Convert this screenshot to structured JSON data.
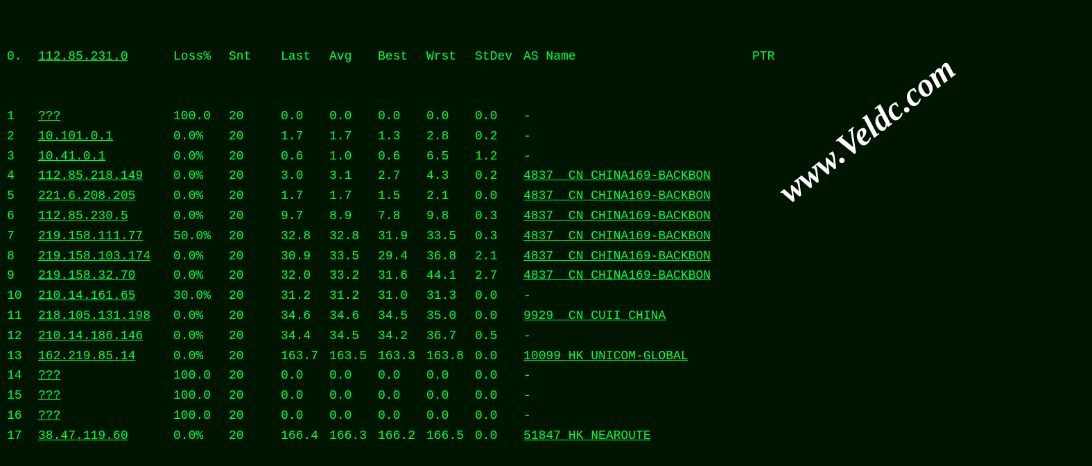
{
  "header": {
    "num": "0.",
    "host": "112.85.231.0",
    "loss": "Loss%",
    "snt": "Snt",
    "last": "Last",
    "avg": "Avg",
    "best": "Best",
    "wrst": "Wrst",
    "stdev": "StDev",
    "asname": "AS Name",
    "ptr": "PTR"
  },
  "rows": [
    {
      "num": "1",
      "host": "???",
      "loss": "100.0",
      "snt": "20",
      "last": "0.0",
      "avg": "0.0",
      "best": "0.0",
      "wrst": "0.0",
      "stdev": "0.0",
      "asname": "-"
    },
    {
      "num": "2",
      "host": "10.101.0.1",
      "loss": "0.0%",
      "snt": "20",
      "last": "1.7",
      "avg": "1.7",
      "best": "1.3",
      "wrst": "2.8",
      "stdev": "0.2",
      "asname": "-"
    },
    {
      "num": "3",
      "host": "10.41.0.1",
      "loss": "0.0%",
      "snt": "20",
      "last": "0.6",
      "avg": "1.0",
      "best": "0.6",
      "wrst": "6.5",
      "stdev": "1.2",
      "asname": "-"
    },
    {
      "num": "4",
      "host": "112.85.218.149",
      "loss": "0.0%",
      "snt": "20",
      "last": "3.0",
      "avg": "3.1",
      "best": "2.7",
      "wrst": "4.3",
      "stdev": "0.2",
      "asname": "4837  CN CHINA169-BACKBON"
    },
    {
      "num": "5",
      "host": "221.6.208.205",
      "loss": "0.0%",
      "snt": "20",
      "last": "1.7",
      "avg": "1.7",
      "best": "1.5",
      "wrst": "2.1",
      "stdev": "0.0",
      "asname": "4837  CN CHINA169-BACKBON"
    },
    {
      "num": "6",
      "host": "112.85.230.5",
      "loss": "0.0%",
      "snt": "20",
      "last": "9.7",
      "avg": "8.9",
      "best": "7.8",
      "wrst": "9.8",
      "stdev": "0.3",
      "asname": "4837  CN CHINA169-BACKBON"
    },
    {
      "num": "7",
      "host": "219.158.111.77",
      "loss": "50.0%",
      "snt": "20",
      "last": "32.8",
      "avg": "32.8",
      "best": "31.9",
      "wrst": "33.5",
      "stdev": "0.3",
      "asname": "4837  CN CHINA169-BACKBON"
    },
    {
      "num": "8",
      "host": "219.158.103.174",
      "loss": "0.0%",
      "snt": "20",
      "last": "30.9",
      "avg": "33.5",
      "best": "29.4",
      "wrst": "36.8",
      "stdev": "2.1",
      "asname": "4837  CN CHINA169-BACKBON"
    },
    {
      "num": "9",
      "host": "219.158.32.70",
      "loss": "0.0%",
      "snt": "20",
      "last": "32.0",
      "avg": "33.2",
      "best": "31.6",
      "wrst": "44.1",
      "stdev": "2.7",
      "asname": "4837  CN CHINA169-BACKBON"
    },
    {
      "num": "10",
      "host": "210.14.161.65",
      "loss": "30.0%",
      "snt": "20",
      "last": "31.2",
      "avg": "31.2",
      "best": "31.0",
      "wrst": "31.3",
      "stdev": "0.0",
      "asname": "-"
    },
    {
      "num": "11",
      "host": "218.105.131.198",
      "loss": "0.0%",
      "snt": "20",
      "last": "34.6",
      "avg": "34.6",
      "best": "34.5",
      "wrst": "35.0",
      "stdev": "0.0",
      "asname": "9929  CN CUII CHINA"
    },
    {
      "num": "12",
      "host": "210.14.186.146",
      "loss": "0.0%",
      "snt": "20",
      "last": "34.4",
      "avg": "34.5",
      "best": "34.2",
      "wrst": "36.7",
      "stdev": "0.5",
      "asname": "-"
    },
    {
      "num": "13",
      "host": "162.219.85.14",
      "loss": "0.0%",
      "snt": "20",
      "last": "163.7",
      "avg": "163.5",
      "best": "163.3",
      "wrst": "163.8",
      "stdev": "0.0",
      "asname": "10099 HK UNICOM-GLOBAL"
    },
    {
      "num": "14",
      "host": "???",
      "loss": "100.0",
      "snt": "20",
      "last": "0.0",
      "avg": "0.0",
      "best": "0.0",
      "wrst": "0.0",
      "stdev": "0.0",
      "asname": "-"
    },
    {
      "num": "15",
      "host": "???",
      "loss": "100.0",
      "snt": "20",
      "last": "0.0",
      "avg": "0.0",
      "best": "0.0",
      "wrst": "0.0",
      "stdev": "0.0",
      "asname": "-"
    },
    {
      "num": "16",
      "host": "???",
      "loss": "100.0",
      "snt": "20",
      "last": "0.0",
      "avg": "0.0",
      "best": "0.0",
      "wrst": "0.0",
      "stdev": "0.0",
      "asname": "-"
    },
    {
      "num": "17",
      "host": "38.47.119.60",
      "loss": "0.0%",
      "snt": "20",
      "last": "166.4",
      "avg": "166.3",
      "best": "166.2",
      "wrst": "166.5",
      "stdev": "0.0",
      "asname": "51847 HK NEAROUTE"
    }
  ],
  "watermark": "www.Veldc.com"
}
